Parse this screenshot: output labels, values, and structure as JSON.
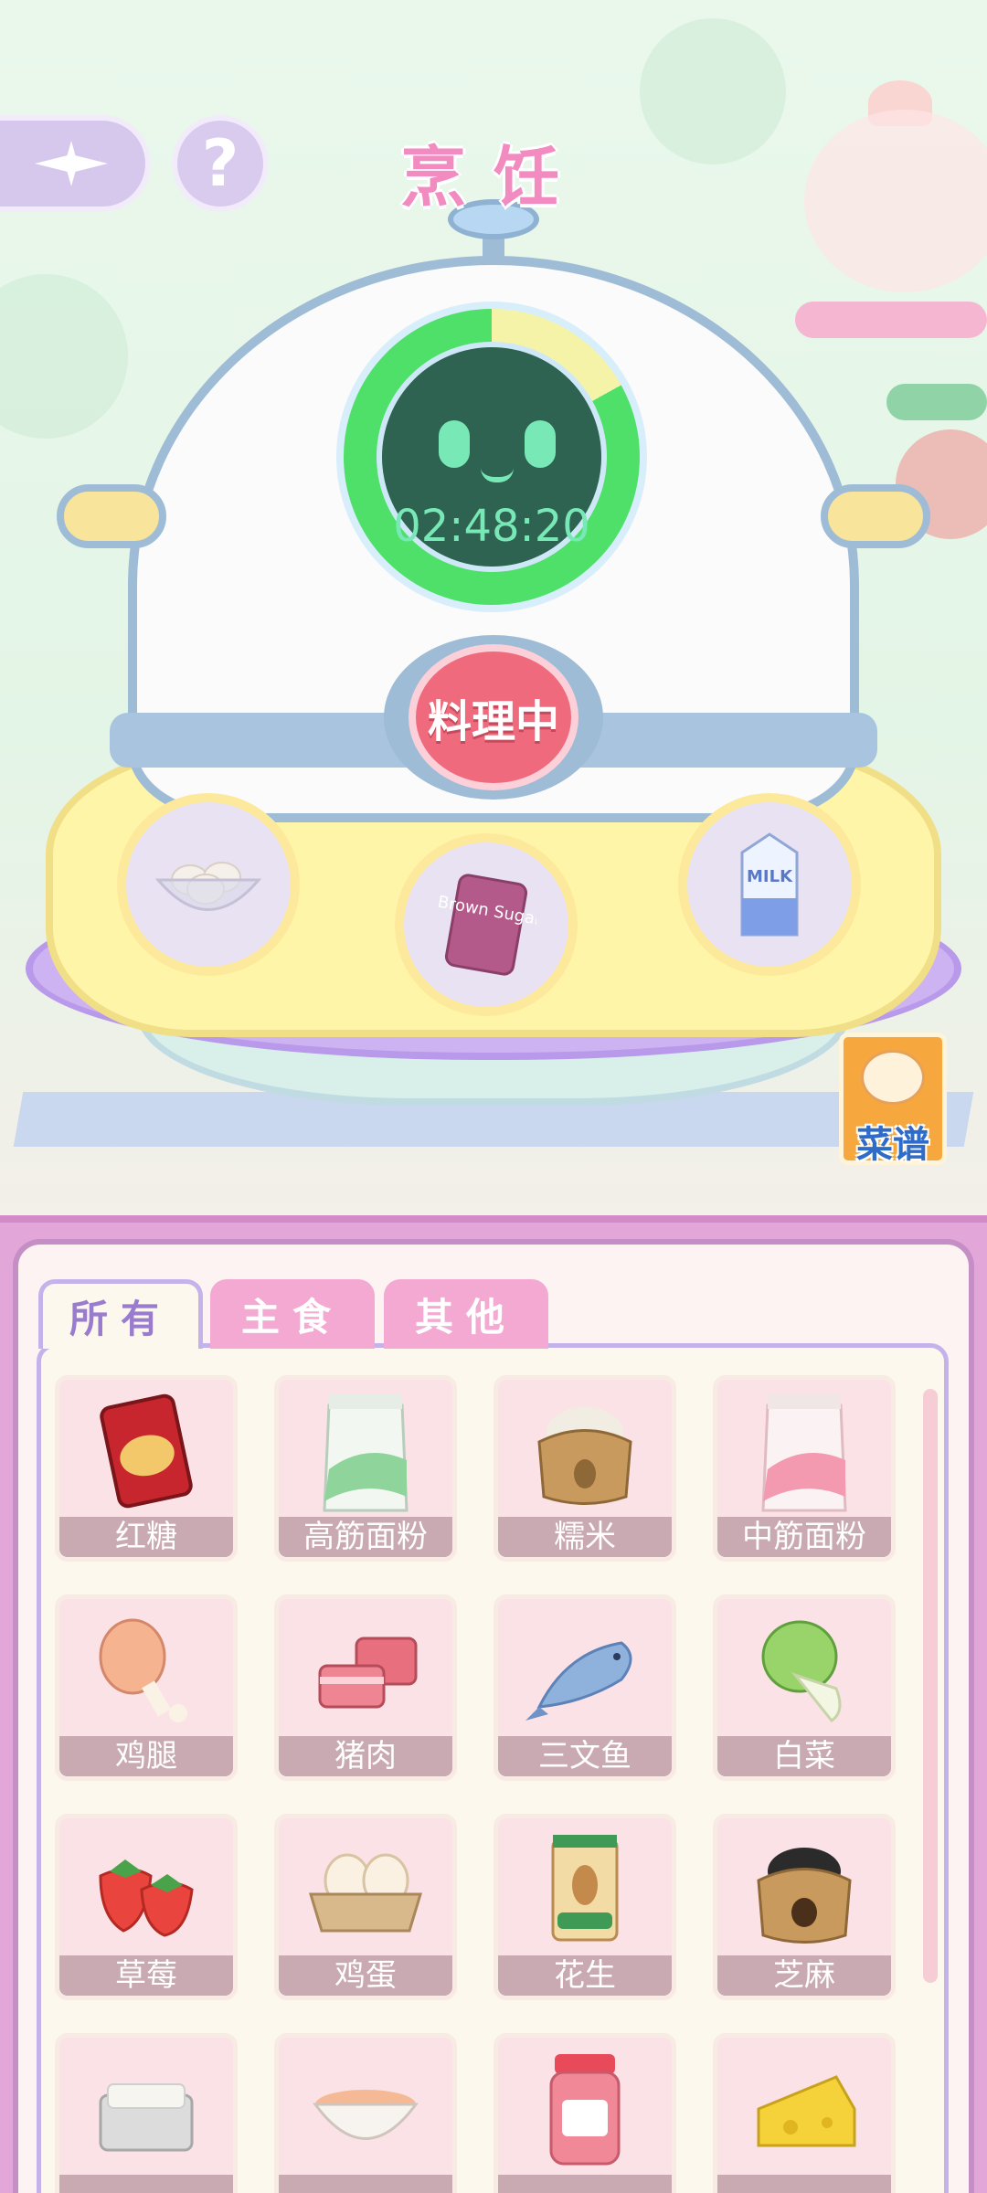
{
  "header": {
    "title": "烹饪",
    "help_symbol": "?"
  },
  "machine": {
    "timer": "02:48:20",
    "progress": 0.17,
    "cook_button_label": "料理中",
    "slots": [
      {
        "name": "egg-bowl",
        "label": ""
      },
      {
        "name": "brown-sugar",
        "label": "Brown Sugar"
      },
      {
        "name": "milk",
        "label": "MILK"
      }
    ]
  },
  "recipe_book": {
    "label": "菜谱"
  },
  "tabs": [
    {
      "label": "所有",
      "active": true
    },
    {
      "label": "主食",
      "active": false
    },
    {
      "label": "其他",
      "active": false
    }
  ],
  "items": [
    {
      "label": "红糖",
      "icon": "brown-sugar-icon"
    },
    {
      "label": "高筋面粉",
      "icon": "flour-green-icon"
    },
    {
      "label": "糯米",
      "icon": "rice-sack-icon"
    },
    {
      "label": "中筋面粉",
      "icon": "flour-pink-icon"
    },
    {
      "label": "鸡腿",
      "icon": "drumstick-icon"
    },
    {
      "label": "猪肉",
      "icon": "pork-icon"
    },
    {
      "label": "三文鱼",
      "icon": "salmon-icon"
    },
    {
      "label": "白菜",
      "icon": "cabbage-icon"
    },
    {
      "label": "草莓",
      "icon": "strawberry-icon"
    },
    {
      "label": "鸡蛋",
      "icon": "eggs-icon"
    },
    {
      "label": "花生",
      "icon": "peanut-icon"
    },
    {
      "label": "芝麻",
      "icon": "sesame-icon"
    },
    {
      "label": "",
      "icon": "tofu-icon"
    },
    {
      "label": "",
      "icon": "soup-bowl-icon"
    },
    {
      "label": "",
      "icon": "jam-jar-icon"
    },
    {
      "label": "",
      "icon": "cheese-icon"
    }
  ],
  "colors": {
    "title": "#f28bc0",
    "timer_green": "#4fe06a",
    "cook_button": "#ef6a7c",
    "panel": "#e3a6d8"
  }
}
